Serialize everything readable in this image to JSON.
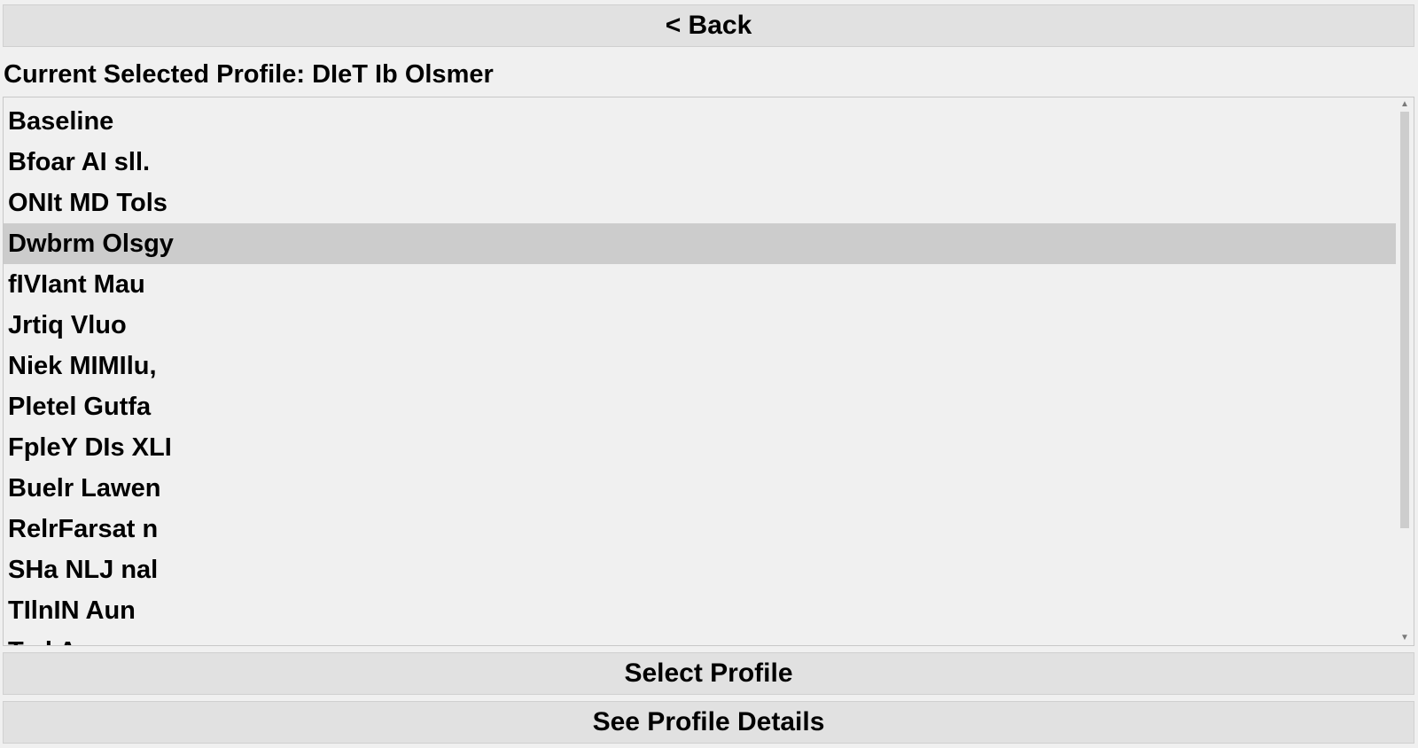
{
  "back_button": {
    "label": "< Back"
  },
  "current_profile": {
    "label": "Current Selected Profile:",
    "value": "DIeT Ib Olsmer"
  },
  "profile_list": {
    "selected_index": 3,
    "items": [
      "Baseline",
      "Bfoar AI sll.",
      "ONIt MD Tols",
      "Dwbrm Olsgy",
      "fIVIant Mau",
      "Jrtiq Vluo",
      "Niek MIMIlu,",
      "Pletel Gutfa",
      "FpleY DIs XLI",
      "Buelr Lawen",
      "RelrFarsat n",
      "SHa NLJ nal",
      "TIlnIN Aun",
      "Tr..l A..."
    ]
  },
  "scrollbar": {
    "up_arrow": "▲",
    "down_arrow": "▼",
    "up_icon": "chevron-up-icon",
    "down_icon": "chevron-down-icon"
  },
  "select_button": {
    "label": "Select Profile"
  },
  "details_button": {
    "label": "See Profile Details"
  },
  "colors": {
    "background": "#f0f0f0",
    "button": "#e1e1e1",
    "selected_row": "#cccccc",
    "scroll_thumb": "#cdcdcd"
  }
}
